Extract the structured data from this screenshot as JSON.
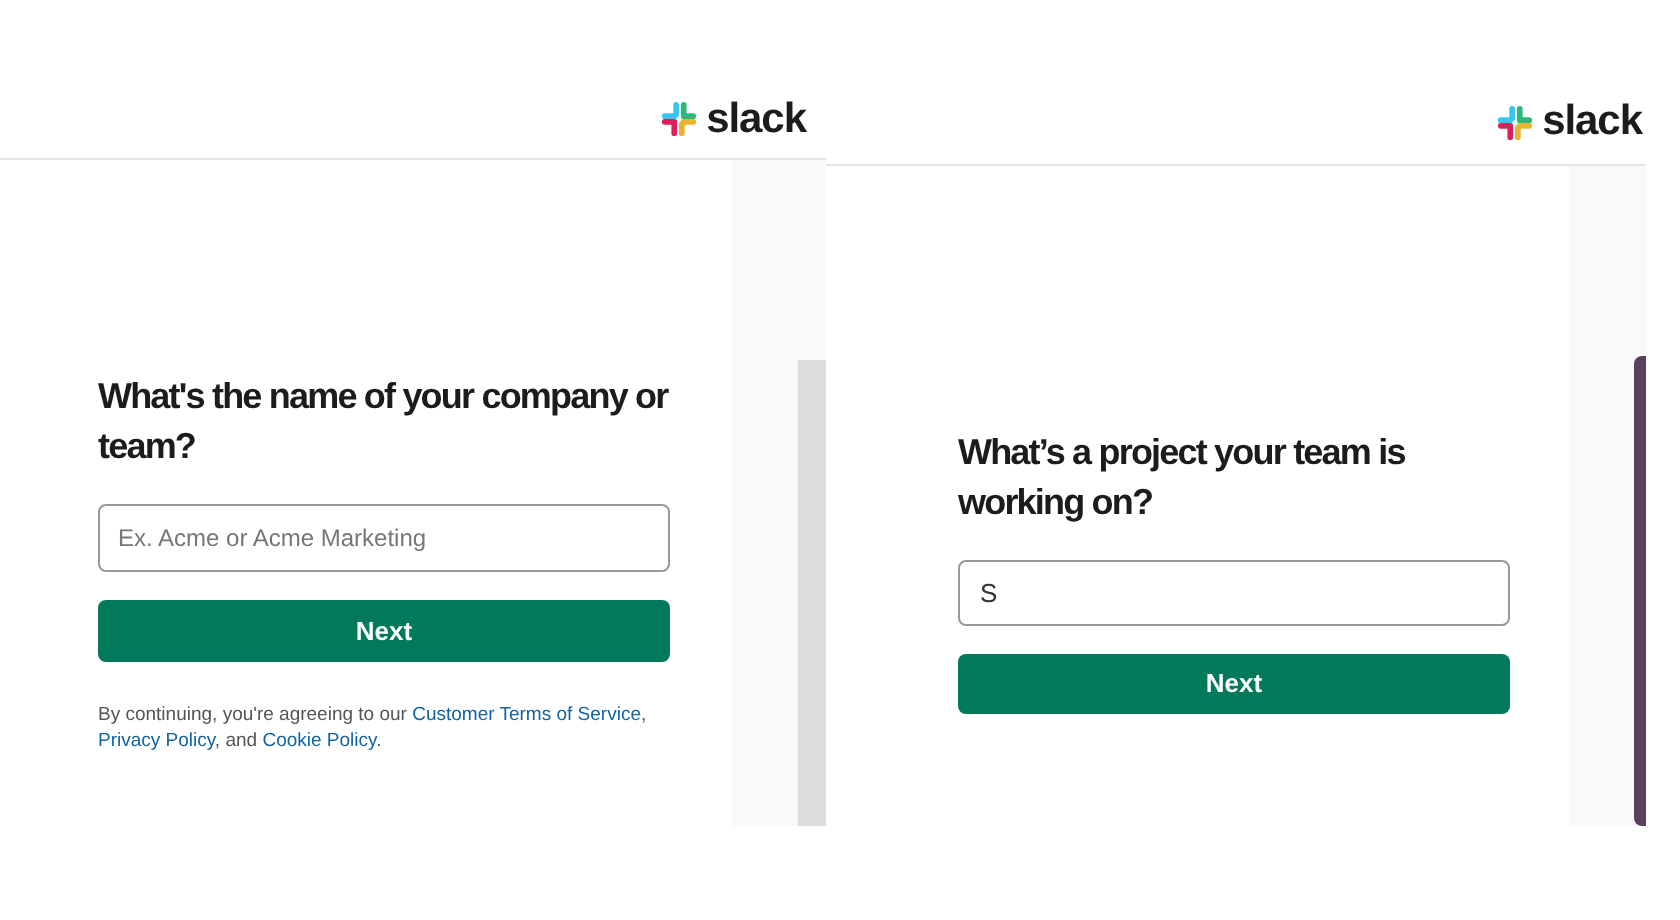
{
  "panels": [
    {
      "logo": "slack",
      "heading": "What's the name of your company or team?",
      "field": {
        "placeholder": "Ex. Acme or Acme Marketing"
      },
      "button": "Next",
      "legal": [
        {
          "kind": "text",
          "text": "By continuing, you're agreeing to our "
        },
        {
          "kind": "link",
          "text": "Customer Terms of Service"
        },
        {
          "kind": "text",
          "text": ", "
        },
        {
          "kind": "link",
          "text": "Privacy Policy"
        },
        {
          "kind": "text",
          "text": ", and "
        },
        {
          "kind": "link",
          "text": "Cookie Policy"
        },
        {
          "kind": "text",
          "text": "."
        }
      ]
    },
    {
      "logo": "slack",
      "heading": "What’s a project your team is working on?",
      "field": {
        "value": "S"
      },
      "button": "Next"
    }
  ]
}
